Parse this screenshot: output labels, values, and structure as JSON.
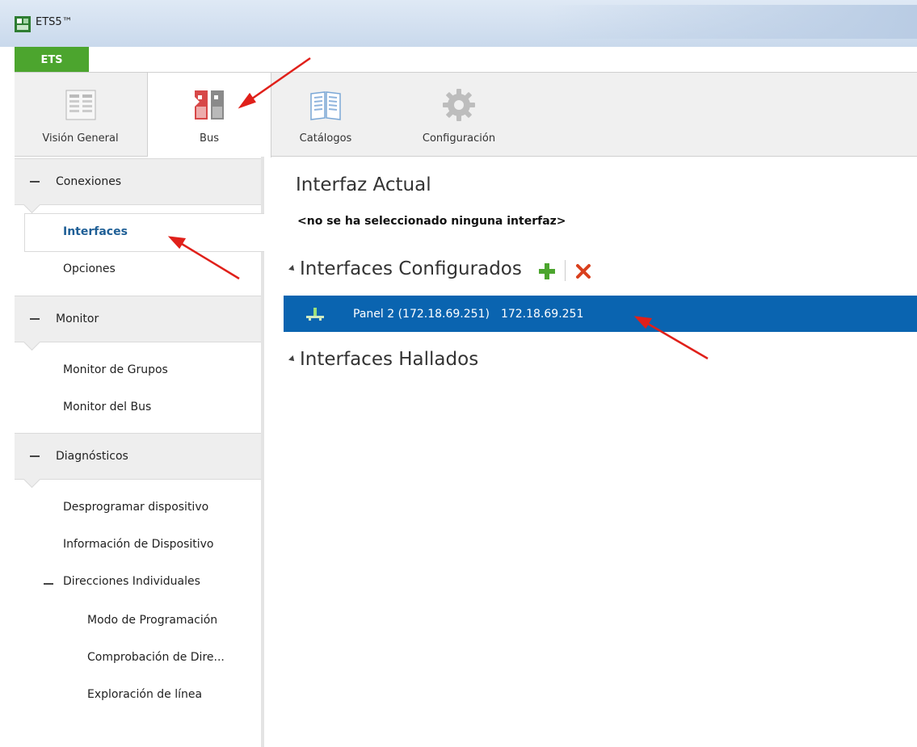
{
  "window": {
    "title": "ETS5™"
  },
  "app_tab": "ETS",
  "ribbon": {
    "tabs": [
      {
        "label": "Visión General",
        "icon": "overview-grid-icon"
      },
      {
        "label": "Bus",
        "icon": "bus-icon"
      },
      {
        "label": "Catálogos",
        "icon": "catalog-book-icon"
      },
      {
        "label": "Configuración",
        "icon": "gear-icon"
      }
    ],
    "active": "Bus"
  },
  "sidebar": {
    "groups": [
      {
        "label": "Conexiones",
        "items": [
          "Interfaces",
          "Opciones"
        ]
      },
      {
        "label": "Monitor",
        "items": [
          "Monitor de Grupos",
          "Monitor del Bus"
        ]
      },
      {
        "label": "Diagnósticos",
        "items": [
          "Desprogramar dispositivo",
          "Información de Dispositivo"
        ],
        "tree": {
          "label": "Direcciones Individuales",
          "children": [
            "Modo de Programación",
            "Comprobación de Dire...",
            "Exploración de línea"
          ]
        }
      }
    ],
    "selected": "Interfaces"
  },
  "main": {
    "current_title": "Interfaz Actual",
    "current_value": "<no se ha seleccionado ninguna interfaz>",
    "configured_title": "Interfaces Configurados",
    "configured": [
      {
        "name": "Panel 2 (172.18.69.251)",
        "ip": "172.18.69.251"
      }
    ],
    "found_title": "Interfaces Hallados"
  },
  "colors": {
    "accent_green": "#4ca52e",
    "selection_blue": "#0a64b0",
    "annotation_red": "#e0201a",
    "link_blue": "#1f5f96"
  }
}
